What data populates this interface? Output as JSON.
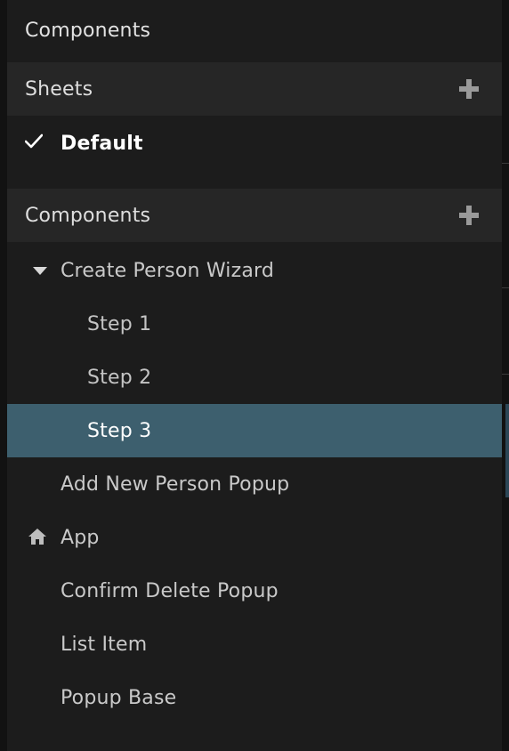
{
  "panel": {
    "title": "Components"
  },
  "sheets": {
    "header": "Sheets",
    "add_icon": "plus-icon",
    "items": [
      {
        "label": "Default",
        "checked": true,
        "icon": "checkmark-icon"
      }
    ]
  },
  "components": {
    "header": "Components",
    "add_icon": "plus-icon",
    "tree": {
      "group": {
        "label": "Create Person Wizard",
        "expanded": true,
        "icon": "caret-down-icon"
      },
      "children": [
        {
          "label": "Step 1"
        },
        {
          "label": "Step 2"
        },
        {
          "label": "Step 3",
          "selected": true
        }
      ],
      "items": [
        {
          "label": "Add New Person Popup"
        },
        {
          "label": "App",
          "icon": "home-icon"
        },
        {
          "label": "Confirm Delete Popup"
        },
        {
          "label": "List Item"
        },
        {
          "label": "Popup Base"
        }
      ]
    }
  },
  "colors": {
    "panel_bg": "#1c1c1c",
    "header_bg": "#262626",
    "selected_bg": "#3d5f6e",
    "text": "#c9c9c9",
    "icon": "#9a9a9a"
  }
}
